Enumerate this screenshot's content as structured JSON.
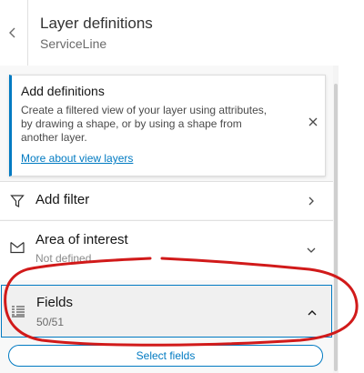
{
  "header": {
    "title": "Layer definitions",
    "subtitle": "ServiceLine",
    "back_icon": "chevron-left-icon"
  },
  "notice": {
    "title": "Add definitions",
    "message": "Create a filtered view of your layer using attributes, by drawing a shape, or by using a shape from another layer.",
    "link": "More about view layers",
    "accent": "#007ac2"
  },
  "rows": {
    "add_filter": {
      "label": "Add filter",
      "icon": "filter-icon"
    },
    "area_of_interest": {
      "label": "Area of interest",
      "value": "Not defined",
      "icon": "area-icon"
    },
    "fields": {
      "label": "Fields",
      "value": "50/51",
      "icon": "list-icon"
    }
  },
  "actions": {
    "select_fields": "Select fields"
  },
  "colors": {
    "accent": "#007ac2",
    "annotation": "#d11a1a"
  }
}
